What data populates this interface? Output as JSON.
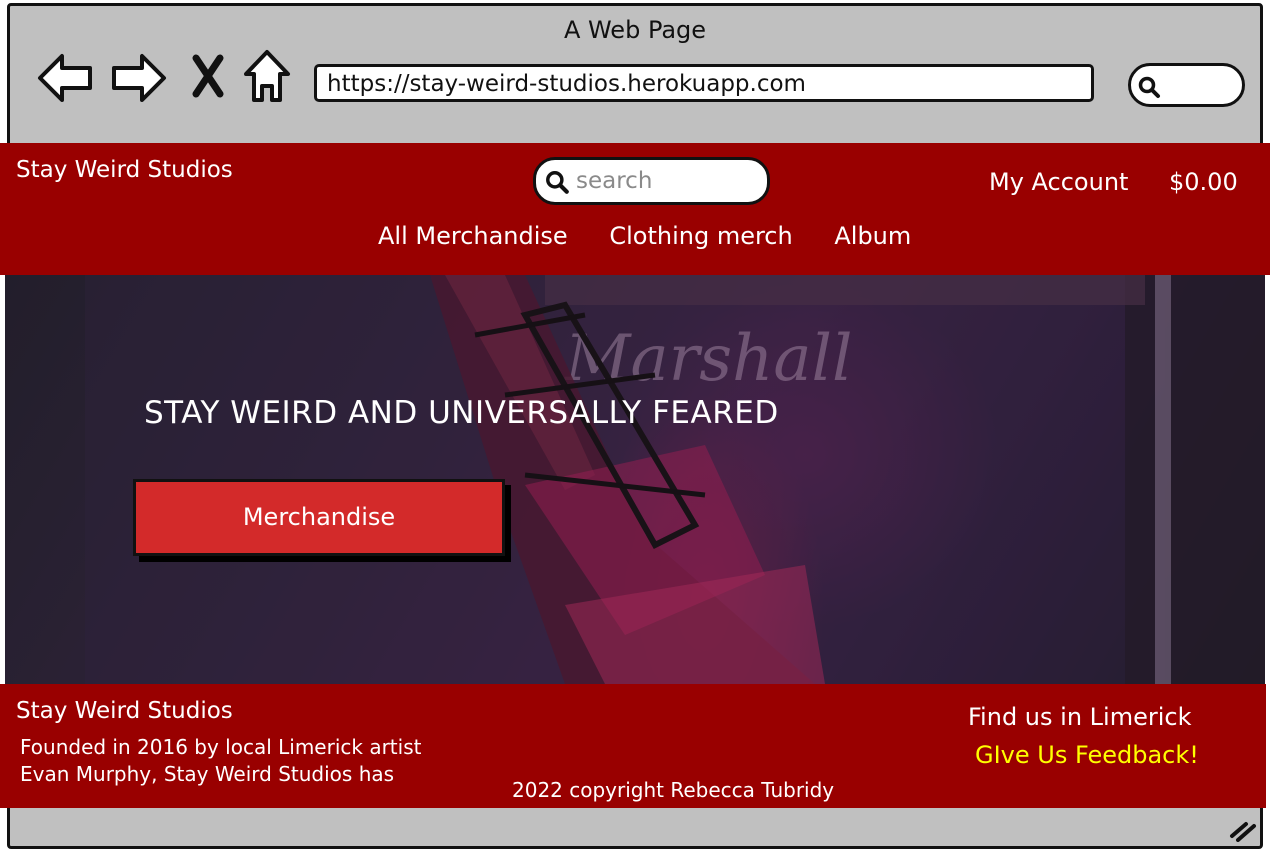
{
  "browser": {
    "title": "A Web Page",
    "url": "https://stay-weird-studios.herokuapp.com",
    "icons": [
      "back-arrow-icon",
      "forward-arrow-icon",
      "close-icon",
      "home-icon",
      "search-icon"
    ]
  },
  "header": {
    "brand": "Stay Weird Studios",
    "search_placeholder": "search",
    "account": "My Account",
    "cart_total": "$0.00",
    "nav": [
      "All Merchandise",
      "Clothing merch",
      "Album"
    ]
  },
  "hero": {
    "title": "STAY WEIRD AND UNIVERSALLY FEARED",
    "button": "Merchandise"
  },
  "footer": {
    "brand": "Stay Weird Studios",
    "about_line1": "Founded in 2016 by local Limerick artist",
    "about_line2": "Evan Murphy, Stay Weird Studios has",
    "copyright": "2022 copyright Rebecca Tubridy",
    "find_us": "Find us in Limerick",
    "feedback": "GIve Us Feedback!"
  },
  "colors": {
    "header_bg": "#990000",
    "button_bg": "#d32a2a",
    "feedback_link": "#ffff00",
    "browser_chrome": "#c0c0c0"
  }
}
